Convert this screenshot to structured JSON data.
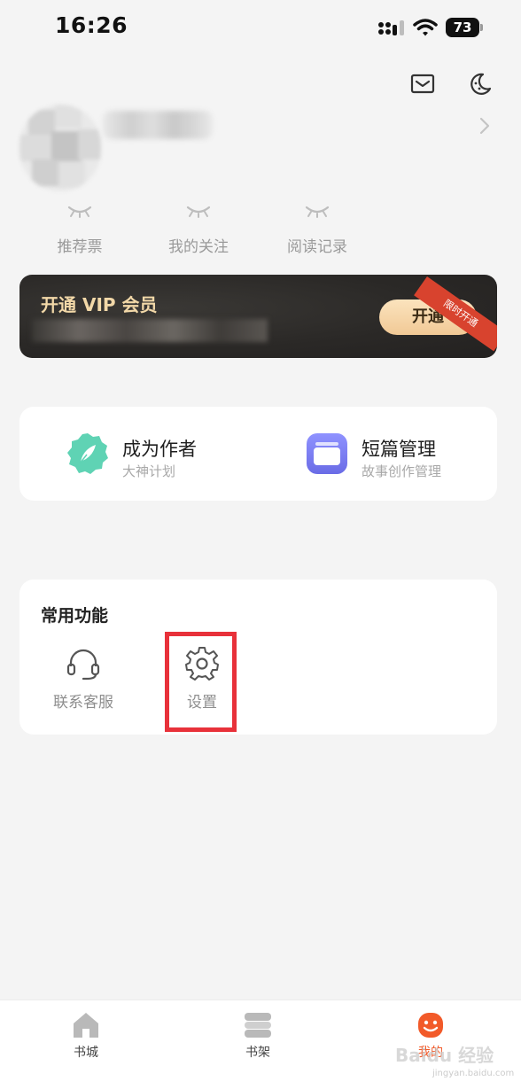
{
  "status_bar": {
    "time": "16:26",
    "battery": "73"
  },
  "header": {
    "icons": [
      "mail-icon",
      "moon-icon",
      "chevron-right-icon"
    ]
  },
  "stats": [
    {
      "label": "推荐票"
    },
    {
      "label": "我的关注"
    },
    {
      "label": "阅读记录"
    }
  ],
  "vip": {
    "title": "开通 VIP 会员",
    "button_label": "开通",
    "ribbon_label": "限时开通"
  },
  "features": [
    {
      "title": "成为作者",
      "subtitle": "大神计划",
      "icon": "feather-icon",
      "color": "#5fd3b4"
    },
    {
      "title": "短篇管理",
      "subtitle": "故事创作管理",
      "icon": "folder-icon",
      "color": "#7a7ef0"
    }
  ],
  "common_functions": {
    "title": "常用功能",
    "items": [
      {
        "label": "联系客服",
        "icon": "headset-icon"
      },
      {
        "label": "设置",
        "icon": "gear-icon"
      }
    ]
  },
  "tabs": [
    {
      "label": "书城",
      "icon": "home-icon"
    },
    {
      "label": "书架",
      "icon": "bookshelf-icon"
    },
    {
      "label": "我的",
      "icon": "smile-icon",
      "active": true
    }
  ],
  "watermark": {
    "main": "Baidu 经验",
    "sub": "jingyan.baidu.com"
  },
  "colors": {
    "accent": "#f25a29",
    "highlight": "#e8313a",
    "vip_gold": "#f2d8a8"
  }
}
